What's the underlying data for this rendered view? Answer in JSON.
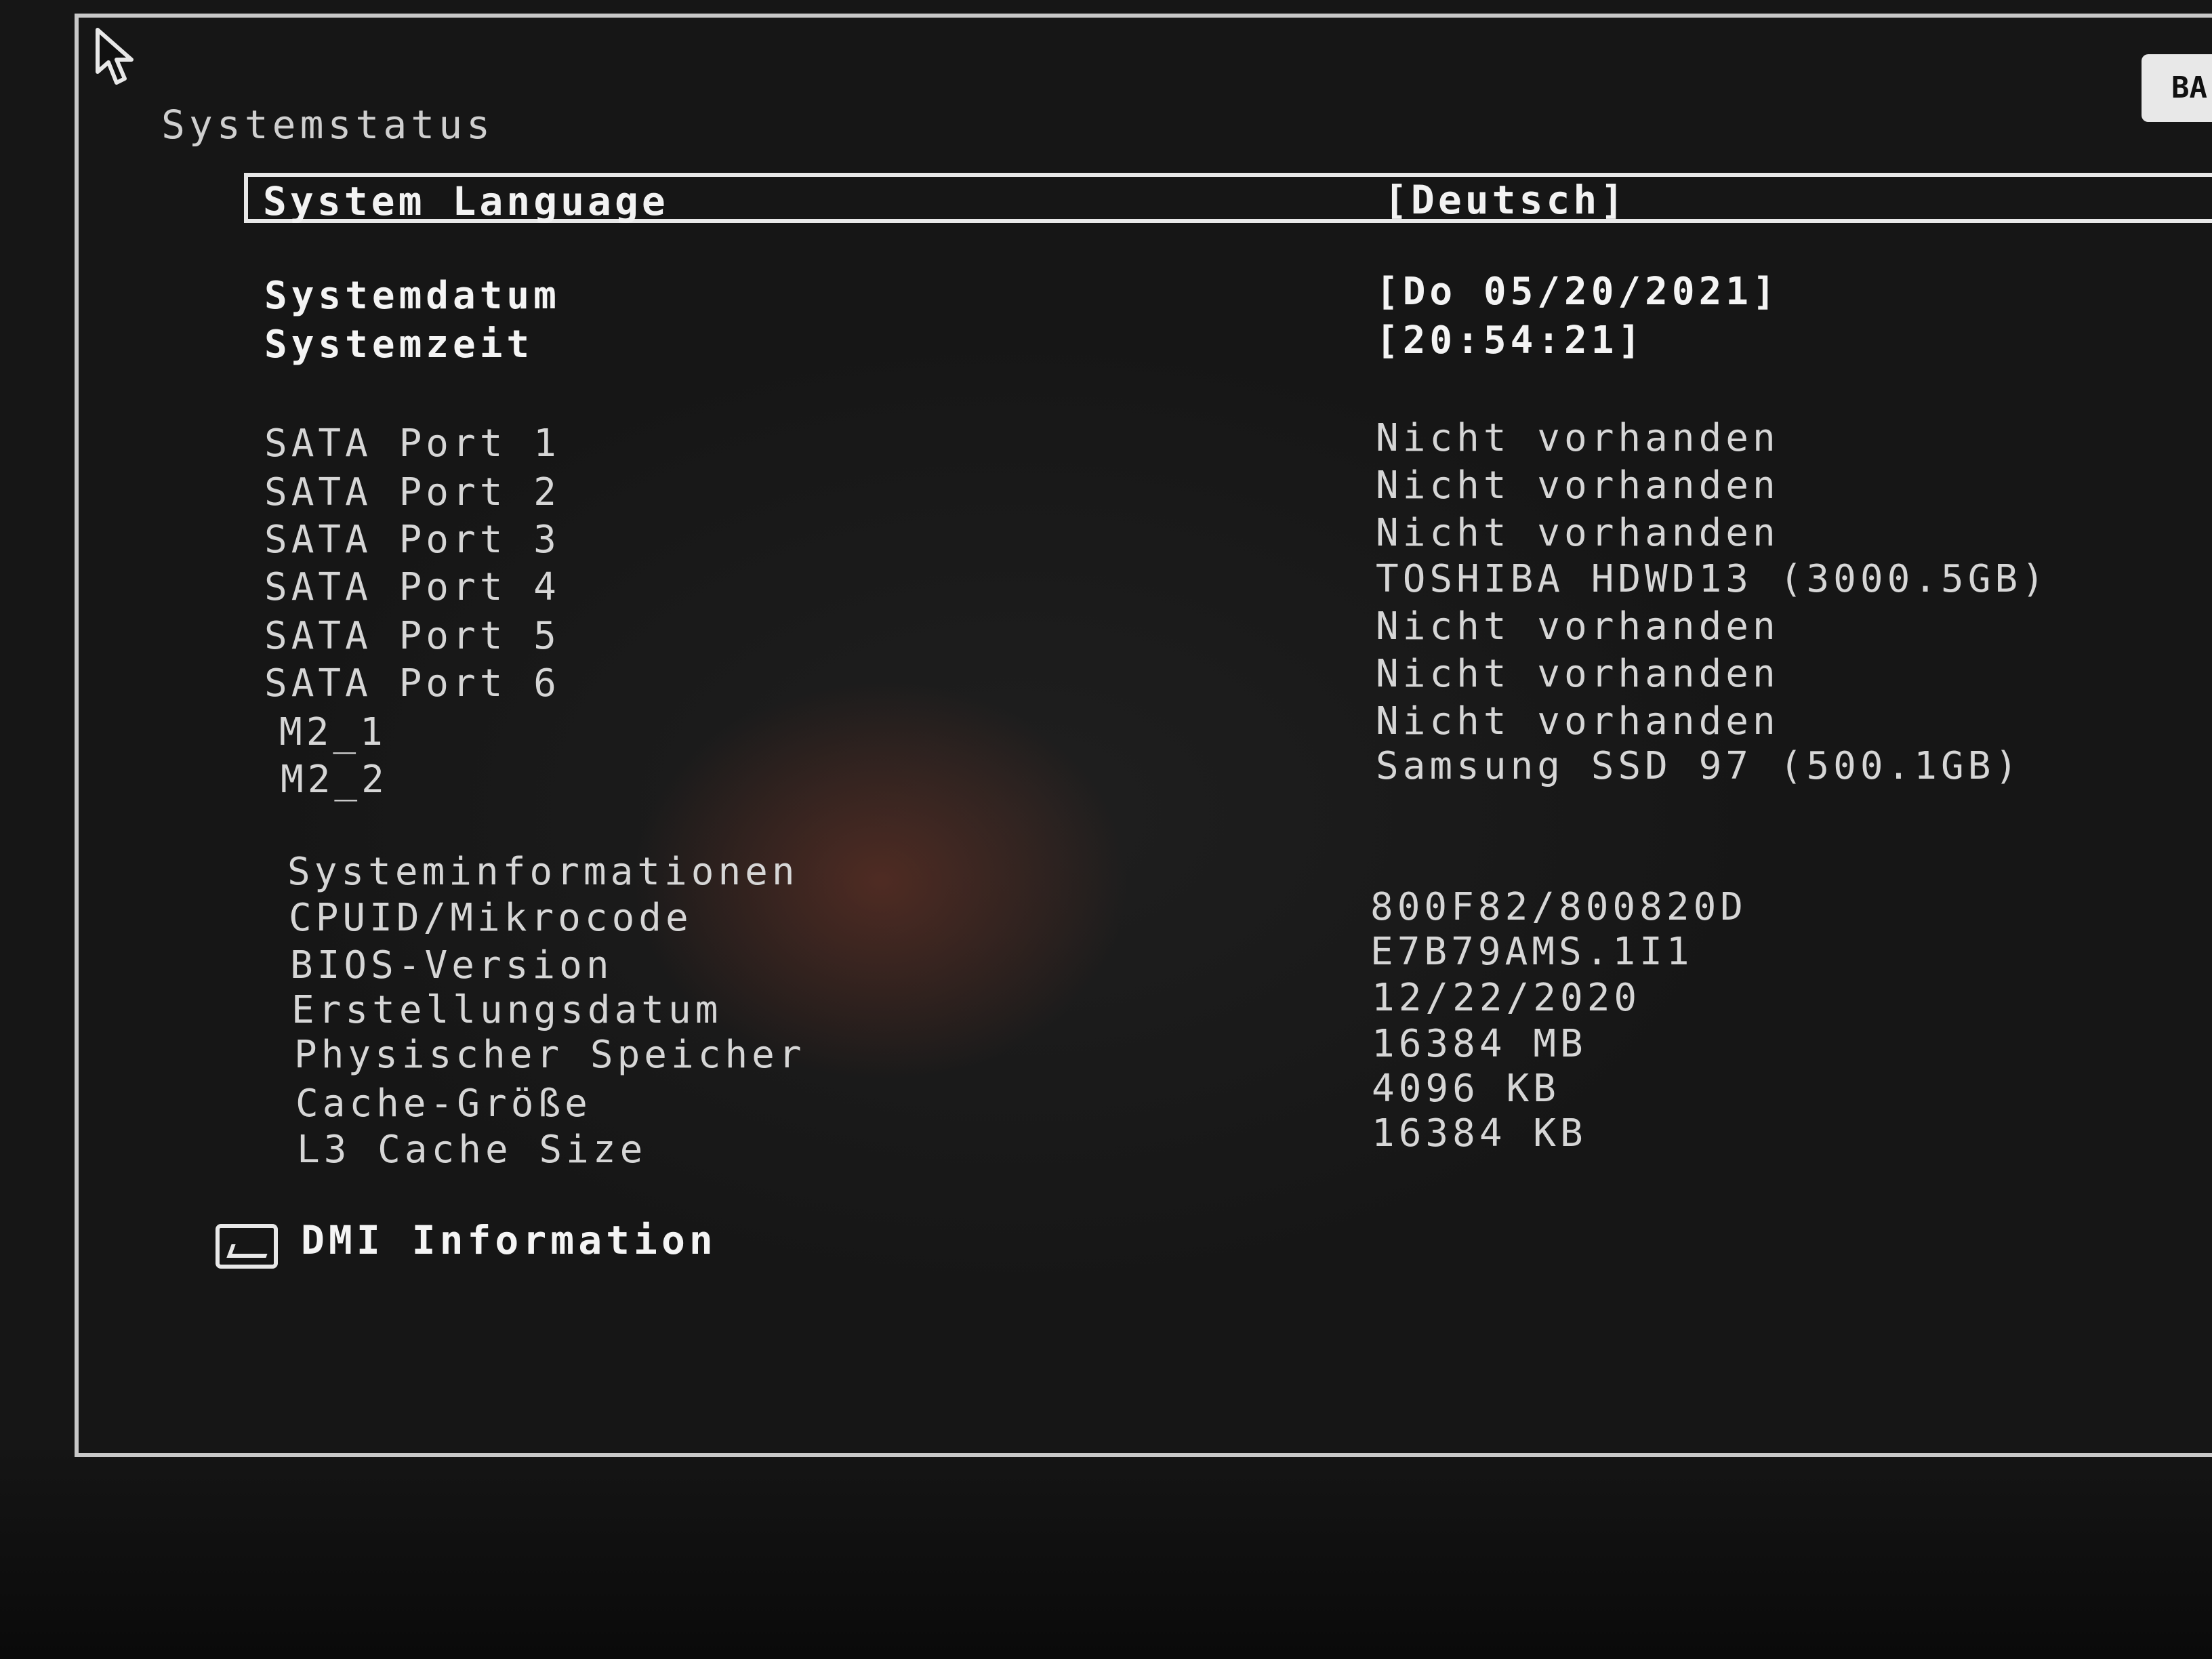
{
  "header": {
    "title": "Systemstatus",
    "top_button_label": "BA"
  },
  "language": {
    "label": "System Language",
    "value": "[Deutsch]"
  },
  "datetime": {
    "date_label": "Systemdatum",
    "date_value": "[Do 05/20/2021]",
    "time_label": "Systemzeit",
    "time_value": "[20:54:21]"
  },
  "ports": [
    {
      "label": "SATA Port 1",
      "value": "Nicht vorhanden"
    },
    {
      "label": "SATA Port 2",
      "value": "Nicht vorhanden"
    },
    {
      "label": "SATA Port 3",
      "value": "Nicht vorhanden"
    },
    {
      "label": "SATA Port 4",
      "value": "TOSHIBA HDWD13 (3000.5GB)"
    },
    {
      "label": "SATA Port 5",
      "value": "Nicht vorhanden"
    },
    {
      "label": "SATA Port 6",
      "value": "Nicht vorhanden"
    },
    {
      "label": "M2_1",
      "value": "Nicht vorhanden"
    },
    {
      "label": "M2_2",
      "value": "Samsung SSD 97 (500.1GB)"
    }
  ],
  "sysinfo": {
    "heading": "Systeminformationen",
    "items": [
      {
        "label": "CPUID/Mikrocode",
        "value": "800F82/800820D"
      },
      {
        "label": "BIOS-Version",
        "value": "E7B79AMS.1I1"
      },
      {
        "label": "Erstellungsdatum",
        "value": "12/22/2020"
      },
      {
        "label": "Physischer Speicher",
        "value": "16384 MB"
      },
      {
        "label": "Cache-Größe",
        "value": "4096 KB"
      },
      {
        "label": "L3 Cache Size",
        "value": "16384 KB"
      }
    ]
  },
  "dmi": {
    "label": "DMI Information",
    "icon": "submenu-icon"
  }
}
